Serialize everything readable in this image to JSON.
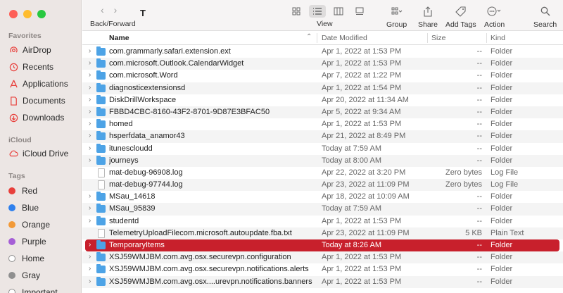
{
  "toolbar": {
    "back_forward_label": "Back/Forward",
    "folder_title": "T",
    "view_label": "View",
    "group_label": "Group",
    "share_label": "Share",
    "add_tags_label": "Add Tags",
    "action_label": "Action",
    "search_label": "Search"
  },
  "sidebar": {
    "favorites_title": "Favorites",
    "favorites": [
      {
        "label": "AirDrop",
        "icon": "airdrop-icon"
      },
      {
        "label": "Recents",
        "icon": "clock-icon"
      },
      {
        "label": "Applications",
        "icon": "applications-icon"
      },
      {
        "label": "Documents",
        "icon": "document-icon"
      },
      {
        "label": "Downloads",
        "icon": "download-icon"
      }
    ],
    "icloud_title": "iCloud",
    "icloud": [
      {
        "label": "iCloud Drive",
        "icon": "cloud-icon"
      }
    ],
    "tags_title": "Tags",
    "tags": [
      {
        "label": "Red",
        "color": "#e8403c"
      },
      {
        "label": "Blue",
        "color": "#2f80ed"
      },
      {
        "label": "Orange",
        "color": "#f29a38"
      },
      {
        "label": "Purple",
        "color": "#a55fd6"
      },
      {
        "label": "Home",
        "color": "#ffffff"
      },
      {
        "label": "Gray",
        "color": "#8f8f8f"
      },
      {
        "label": "Important",
        "color": "#ffffff"
      }
    ]
  },
  "columns": {
    "name": "Name",
    "date_modified": "Date Modified",
    "size": "Size",
    "kind": "Kind"
  },
  "files": [
    {
      "name": "com.grammarly.safari.extension.ext",
      "date": "Apr 1, 2022 at 1:53 PM",
      "size": "--",
      "kind": "Folder",
      "type": "folder"
    },
    {
      "name": "com.microsoft.Outlook.CalendarWidget",
      "date": "Apr 1, 2022 at 1:53 PM",
      "size": "--",
      "kind": "Folder",
      "type": "folder"
    },
    {
      "name": "com.microsoft.Word",
      "date": "Apr 7, 2022 at 1:22 PM",
      "size": "--",
      "kind": "Folder",
      "type": "folder"
    },
    {
      "name": "diagnosticextensionsd",
      "date": "Apr 1, 2022 at 1:54 PM",
      "size": "--",
      "kind": "Folder",
      "type": "folder"
    },
    {
      "name": "DiskDrillWorkspace",
      "date": "Apr 20, 2022 at 11:34 AM",
      "size": "--",
      "kind": "Folder",
      "type": "folder"
    },
    {
      "name": "FBBD4CBC-8160-43F2-8701-9D87E3BFAC50",
      "date": "Apr 5, 2022 at 9:34 AM",
      "size": "--",
      "kind": "Folder",
      "type": "folder"
    },
    {
      "name": "homed",
      "date": "Apr 1, 2022 at 1:53 PM",
      "size": "--",
      "kind": "Folder",
      "type": "folder"
    },
    {
      "name": "hsperfdata_anamor43",
      "date": "Apr 21, 2022 at 8:49 PM",
      "size": "--",
      "kind": "Folder",
      "type": "folder"
    },
    {
      "name": "itunescloudd",
      "date": "Today at 7:59 AM",
      "size": "--",
      "kind": "Folder",
      "type": "folder"
    },
    {
      "name": "journeys",
      "date": "Today at 8:00 AM",
      "size": "--",
      "kind": "Folder",
      "type": "folder"
    },
    {
      "name": "mat-debug-96908.log",
      "date": "Apr 22, 2022 at 3:20 PM",
      "size": "Zero bytes",
      "kind": "Log File",
      "type": "file"
    },
    {
      "name": "mat-debug-97744.log",
      "date": "Apr 23, 2022 at 11:09 PM",
      "size": "Zero bytes",
      "kind": "Log File",
      "type": "file"
    },
    {
      "name": "MSau_14618",
      "date": "Apr 18, 2022 at 10:09 AM",
      "size": "--",
      "kind": "Folder",
      "type": "folder"
    },
    {
      "name": "MSau_95839",
      "date": "Today at 7:59 AM",
      "size": "--",
      "kind": "Folder",
      "type": "folder"
    },
    {
      "name": "studentd",
      "date": "Apr 1, 2022 at 1:53 PM",
      "size": "--",
      "kind": "Folder",
      "type": "folder"
    },
    {
      "name": "TelemetryUploadFilecom.microsoft.autoupdate.fba.txt",
      "date": "Apr 23, 2022 at 11:09 PM",
      "size": "5 KB",
      "kind": "Plain Text",
      "type": "file"
    },
    {
      "name": "TemporaryItems",
      "date": "Today at 8:26 AM",
      "size": "--",
      "kind": "Folder",
      "type": "folder",
      "selected": true
    },
    {
      "name": "XSJ59WMJBM.com.avg.osx.securevpn.configuration",
      "date": "Apr 1, 2022 at 1:53 PM",
      "size": "--",
      "kind": "Folder",
      "type": "folder"
    },
    {
      "name": "XSJ59WMJBM.com.avg.osx.securevpn.notifications.alerts",
      "date": "Apr 1, 2022 at 1:53 PM",
      "size": "--",
      "kind": "Folder",
      "type": "folder"
    },
    {
      "name": "XSJ59WMJBM.com.avg.osx....urevpn.notifications.banners",
      "date": "Apr 1, 2022 at 1:53 PM",
      "size": "--",
      "kind": "Folder",
      "type": "folder"
    }
  ],
  "colors": {
    "selection": "#c8202c",
    "folder": "#4da3e6",
    "sidebar_bg": "#ece6e4"
  }
}
